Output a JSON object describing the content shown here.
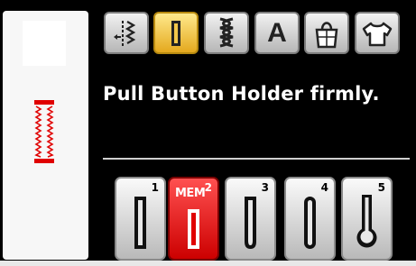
{
  "preview": {
    "stitch_icon": "buttonhole-stitch-preview-icon",
    "stitch_color": "#e00000"
  },
  "tabs": [
    {
      "name": "utility-stitch",
      "icon": "utility-stitch-icon",
      "active": false
    },
    {
      "name": "buttonhole",
      "icon": "buttonhole-icon",
      "active": true
    },
    {
      "name": "decorative-stitch",
      "icon": "decorative-stitch-icon",
      "active": false
    },
    {
      "name": "character",
      "icon": "letter-a-icon",
      "label": "A",
      "active": false
    },
    {
      "name": "quilt",
      "icon": "quilt-bag-icon",
      "active": false
    },
    {
      "name": "garment",
      "icon": "shirt-icon",
      "active": false
    }
  ],
  "message": "Pull Button Holder firmly.",
  "buttonholes": [
    {
      "number": "1",
      "icon": "square-buttonhole-icon",
      "selected": false
    },
    {
      "number": "2",
      "label": "MEM",
      "icon": "square-buttonhole-icon",
      "selected": true
    },
    {
      "number": "3",
      "icon": "rounded-buttonhole-icon",
      "selected": false
    },
    {
      "number": "4",
      "icon": "round-end-buttonhole-icon",
      "selected": false
    },
    {
      "number": "5",
      "icon": "keyhole-buttonhole-icon",
      "selected": false
    }
  ],
  "colors": {
    "active_tab": "#f5c542",
    "selected_key": "#e00000",
    "message_text": "#ffffff",
    "background": "#000000"
  }
}
